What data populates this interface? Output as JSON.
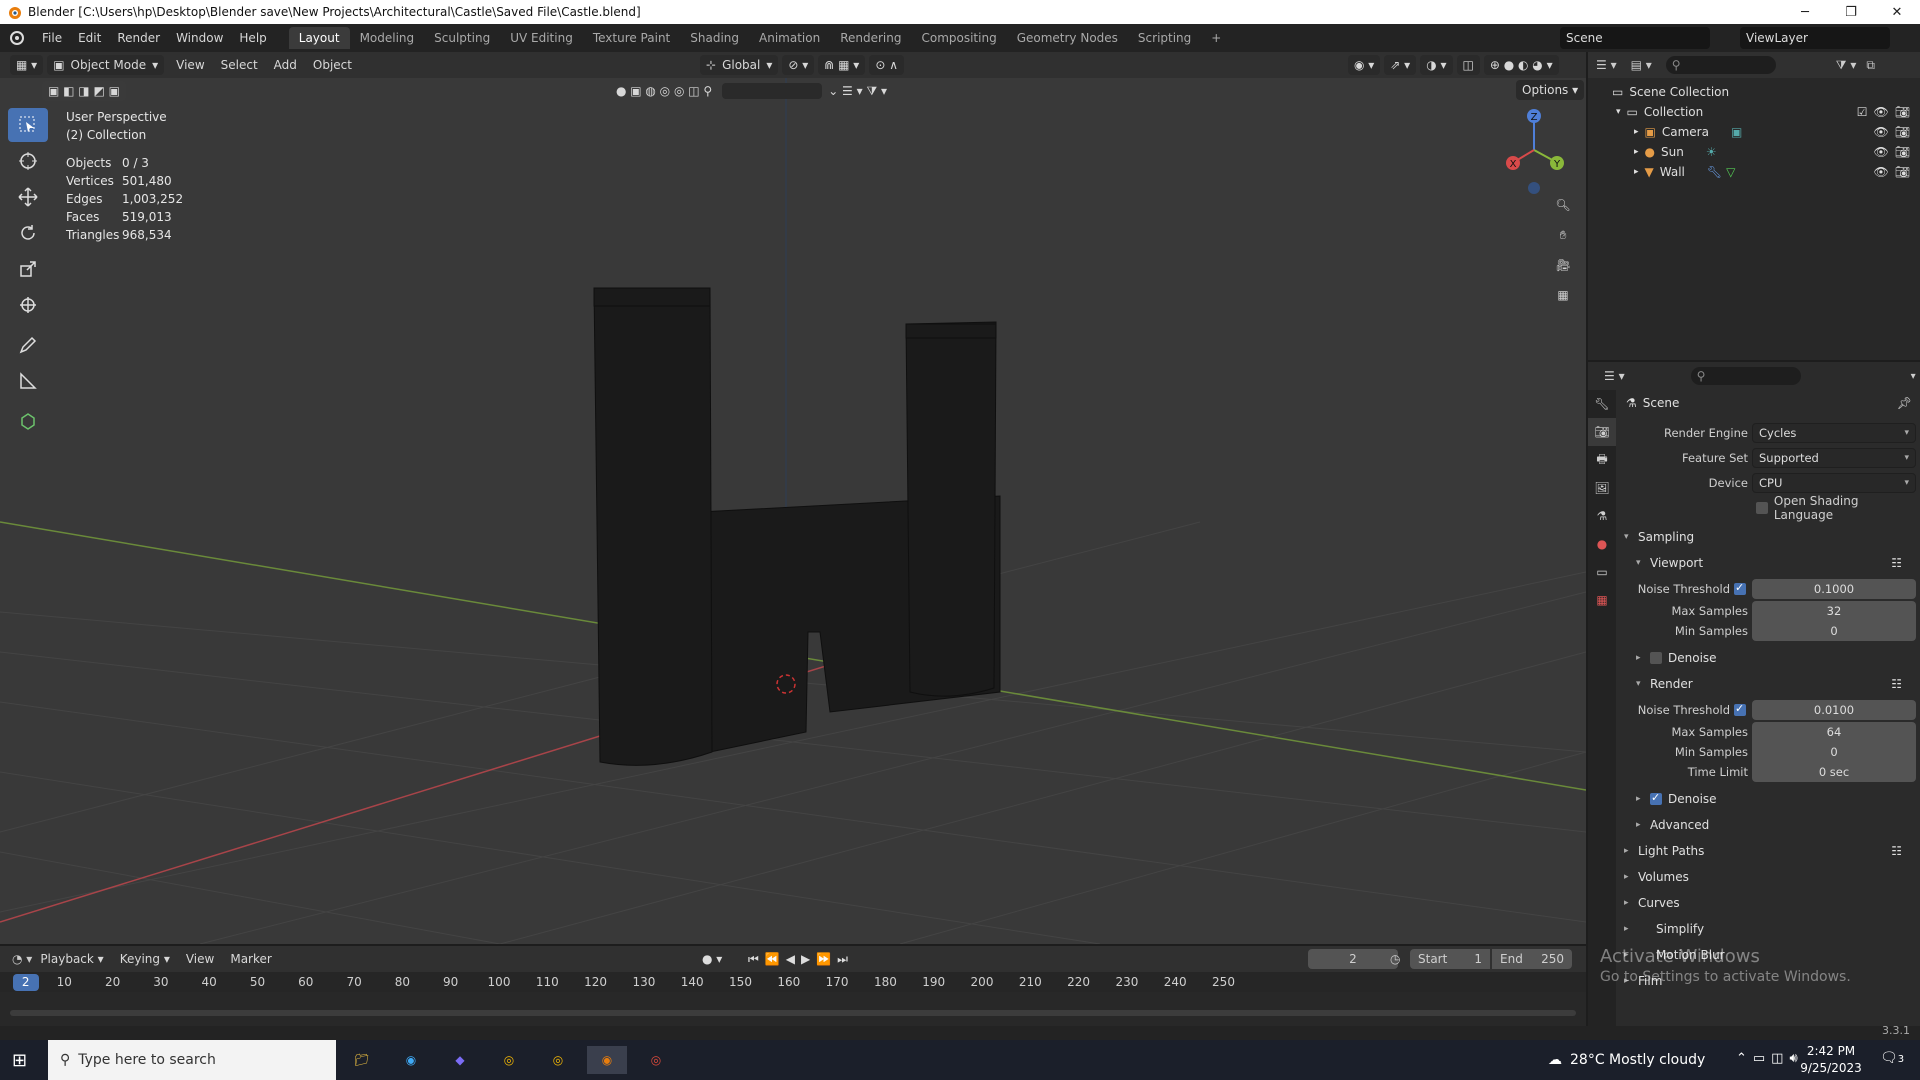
{
  "window": {
    "title": "Blender [C:\\Users\\hp\\Desktop\\Blender save\\New Projects\\Architectural\\Castle\\Saved File\\Castle.blend]",
    "controls": [
      "minimize",
      "maximize",
      "close"
    ]
  },
  "menu": [
    "File",
    "Edit",
    "Render",
    "Window",
    "Help"
  ],
  "workspaces": [
    {
      "label": "Layout",
      "active": true
    },
    {
      "label": "Modeling"
    },
    {
      "label": "Sculpting"
    },
    {
      "label": "UV Editing"
    },
    {
      "label": "Texture Paint"
    },
    {
      "label": "Shading"
    },
    {
      "label": "Animation"
    },
    {
      "label": "Rendering"
    },
    {
      "label": "Compositing"
    },
    {
      "label": "Geometry Nodes"
    },
    {
      "label": "Scripting"
    }
  ],
  "add_workspace": "+",
  "scene_name": "Scene",
  "view_layer": "ViewLayer",
  "viewport": {
    "mode": "Object Mode",
    "menus": [
      "View",
      "Select",
      "Add",
      "Object"
    ],
    "orientation": "Global",
    "options_label": "Options",
    "view_name": "User Perspective",
    "collection_label": "(2) Collection",
    "stats": [
      {
        "label": "Objects",
        "value": "0 / 3"
      },
      {
        "label": "Vertices",
        "value": "501,480"
      },
      {
        "label": "Edges",
        "value": "1,003,252"
      },
      {
        "label": "Faces",
        "value": "519,013"
      },
      {
        "label": "Triangles",
        "value": "968,534"
      }
    ],
    "gizmo_axes": {
      "x": "X",
      "y": "Y",
      "z": "Z"
    },
    "colors": {
      "background": "#393939",
      "x_axis": "#c8484f",
      "y_axis": "#7aa83a",
      "active_tool": "#4772b3"
    }
  },
  "outliner": {
    "root": "Scene Collection",
    "collection": "Collection",
    "items": [
      {
        "label": "Camera",
        "icon": "camera-icon"
      },
      {
        "label": "Sun",
        "icon": "sun-light-icon"
      },
      {
        "label": "Wall",
        "icon": "mesh-icon"
      }
    ]
  },
  "properties": {
    "context": "Scene",
    "render_engine": {
      "label": "Render Engine",
      "value": "Cycles"
    },
    "feature_set": {
      "label": "Feature Set",
      "value": "Supported"
    },
    "device": {
      "label": "Device",
      "value": "CPU"
    },
    "osl": {
      "label": "Open Shading Language",
      "checked": false
    },
    "sampling": {
      "label": "Sampling",
      "viewport": {
        "label": "Viewport",
        "noise_threshold": {
          "label": "Noise Threshold",
          "value": "0.1000",
          "checked": true
        },
        "max_samples": {
          "label": "Max Samples",
          "value": "32"
        },
        "min_samples": {
          "label": "Min Samples",
          "value": "0"
        },
        "denoise": {
          "label": "Denoise",
          "checked": false
        }
      },
      "render": {
        "label": "Render",
        "noise_threshold": {
          "label": "Noise Threshold",
          "value": "0.0100",
          "checked": true
        },
        "max_samples": {
          "label": "Max Samples",
          "value": "64"
        },
        "min_samples": {
          "label": "Min Samples",
          "value": "0"
        },
        "time_limit": {
          "label": "Time Limit",
          "value": "0 sec"
        },
        "denoise": {
          "label": "Denoise",
          "checked": true
        }
      },
      "advanced": "Advanced"
    },
    "panels": [
      "Light Paths",
      "Volumes",
      "Curves",
      "Simplify",
      "Motion Blur",
      "Film"
    ]
  },
  "timeline": {
    "menus": [
      "Playback",
      "Keying",
      "View",
      "Marker"
    ],
    "current_frame": "2",
    "start_label": "Start",
    "start": "1",
    "end_label": "End",
    "end": "250",
    "ticks": [
      "10",
      "20",
      "30",
      "40",
      "50",
      "60",
      "70",
      "80",
      "90",
      "100",
      "110",
      "120",
      "130",
      "140",
      "150",
      "160",
      "170",
      "180",
      "190",
      "200",
      "210",
      "220",
      "230",
      "240",
      "250"
    ]
  },
  "status": {
    "version": "3.3.1"
  },
  "activation": {
    "title": "Activate Windows",
    "subtitle": "Go to Settings to activate Windows."
  },
  "taskbar": {
    "search_placeholder": "Type here to search",
    "weather": "28°C  Mostly cloudy",
    "time": "2:42 PM",
    "date": "9/25/2023",
    "notification_count": "3"
  }
}
